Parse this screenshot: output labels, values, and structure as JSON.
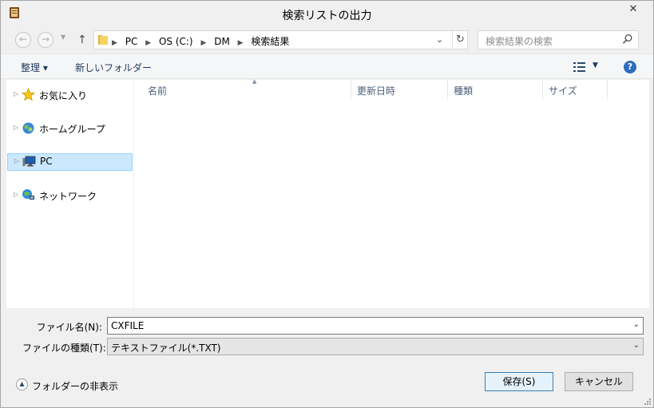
{
  "window": {
    "title": "検索リストの出力",
    "close_label": "✕"
  },
  "nav": {
    "back_icon": "back-arrow-icon",
    "forward_icon": "forward-arrow-icon",
    "up_icon": "up-arrow-icon",
    "breadcrumbs": [
      "PC",
      "OS (C:)",
      "DM",
      "検索結果"
    ],
    "search_placeholder": "検索結果の検索"
  },
  "toolbar": {
    "organize_label": "整理 ▾",
    "new_folder_label": "新しいフォルダー",
    "help_label": "?"
  },
  "sidebar": {
    "items": [
      {
        "label": "お気に入り",
        "icon": "star-icon"
      },
      {
        "label": "ホームグループ",
        "icon": "homegroup-icon"
      },
      {
        "label": "PC",
        "icon": "computer-icon",
        "selected": true
      },
      {
        "label": "ネットワーク",
        "icon": "network-icon"
      }
    ]
  },
  "columns": [
    "名前",
    "更新日時",
    "種類",
    "サイズ"
  ],
  "form": {
    "filename_label": "ファイル名(N):",
    "filename_value": "CXFILE",
    "filetype_label": "ファイルの種類(T):",
    "filetype_value": "テキストファイル(*.TXT)",
    "hide_folders_label": "フォルダーの非表示",
    "save_label": "保存(S)",
    "cancel_label": "キャンセル"
  },
  "colors": {
    "selection_bg": "#cce8ff",
    "selection_border": "#99d1ff",
    "link_text": "#1e395b",
    "header_text": "#4c607a",
    "primary_border": "#3c7fb1"
  }
}
